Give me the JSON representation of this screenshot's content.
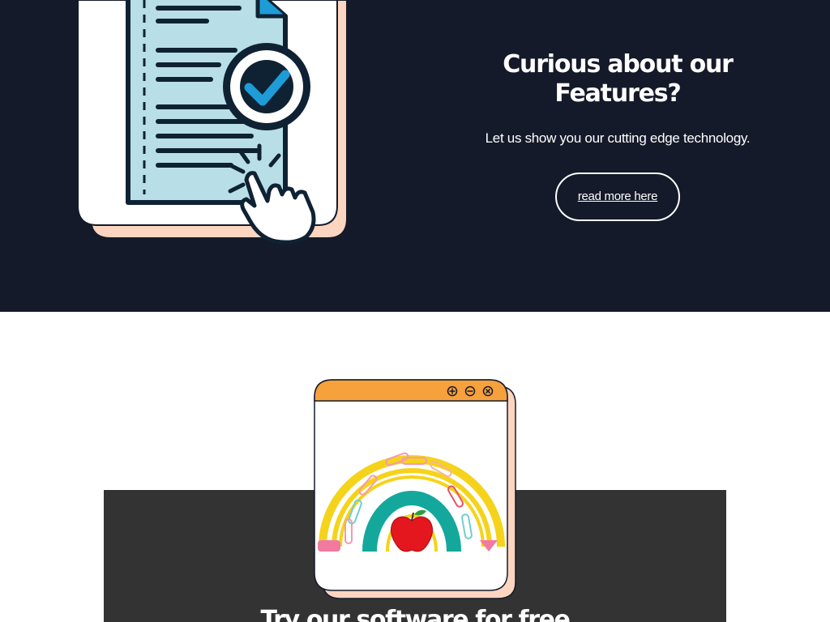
{
  "hero": {
    "title": "Curious about our Features?",
    "subtitle": "Let us show you our cutting edge technology.",
    "cta_label": "read more here",
    "illustration_icons": [
      "document-icon",
      "checkmark-badge-icon",
      "pointer-hand-icon"
    ]
  },
  "lower": {
    "title": "Try our software for free",
    "window_controls": [
      "add-icon",
      "minimize-icon",
      "close-icon"
    ],
    "illustration": "rainbow-apple-icon"
  },
  "colors": {
    "hero_bg": "#141a29",
    "card_shadow": "#fcd5c0",
    "document_fill": "#b8dfe8",
    "check_blue": "#1e9cd7",
    "window_titlebar": "#f7a13c",
    "band_bg": "#333333"
  }
}
